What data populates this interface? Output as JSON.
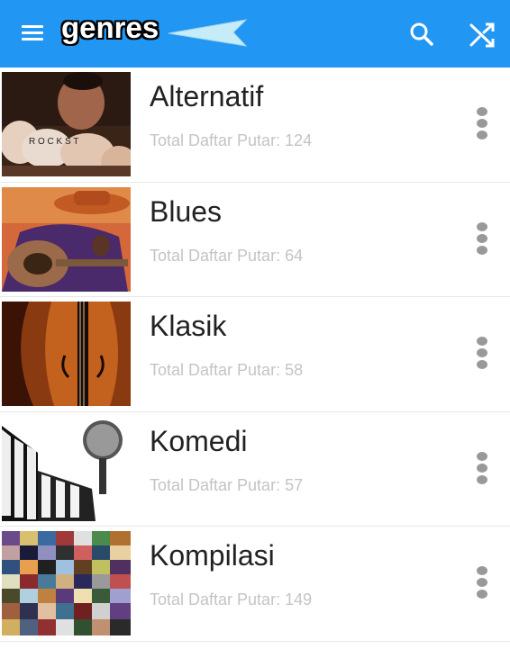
{
  "appbar": {
    "title": "genres",
    "background": "#2196f3",
    "icons": [
      "hamburger-menu-icon",
      "search-icon",
      "shuffle-icon"
    ]
  },
  "genres": [
    {
      "name": "Alternatif",
      "count_label": "Total Daftar Putar: 124",
      "thumb": "rock-fist"
    },
    {
      "name": "Blues",
      "count_label": "Total Daftar Putar: 64",
      "thumb": "blues-guitarist"
    },
    {
      "name": "Klasik",
      "count_label": "Total Daftar Putar: 58",
      "thumb": "violin"
    },
    {
      "name": "Komedi",
      "count_label": "Total Daftar Putar: 57",
      "thumb": "microphone-piano"
    },
    {
      "name": "Kompilasi",
      "count_label": "Total Daftar Putar: 149",
      "thumb": "album-collage"
    }
  ]
}
